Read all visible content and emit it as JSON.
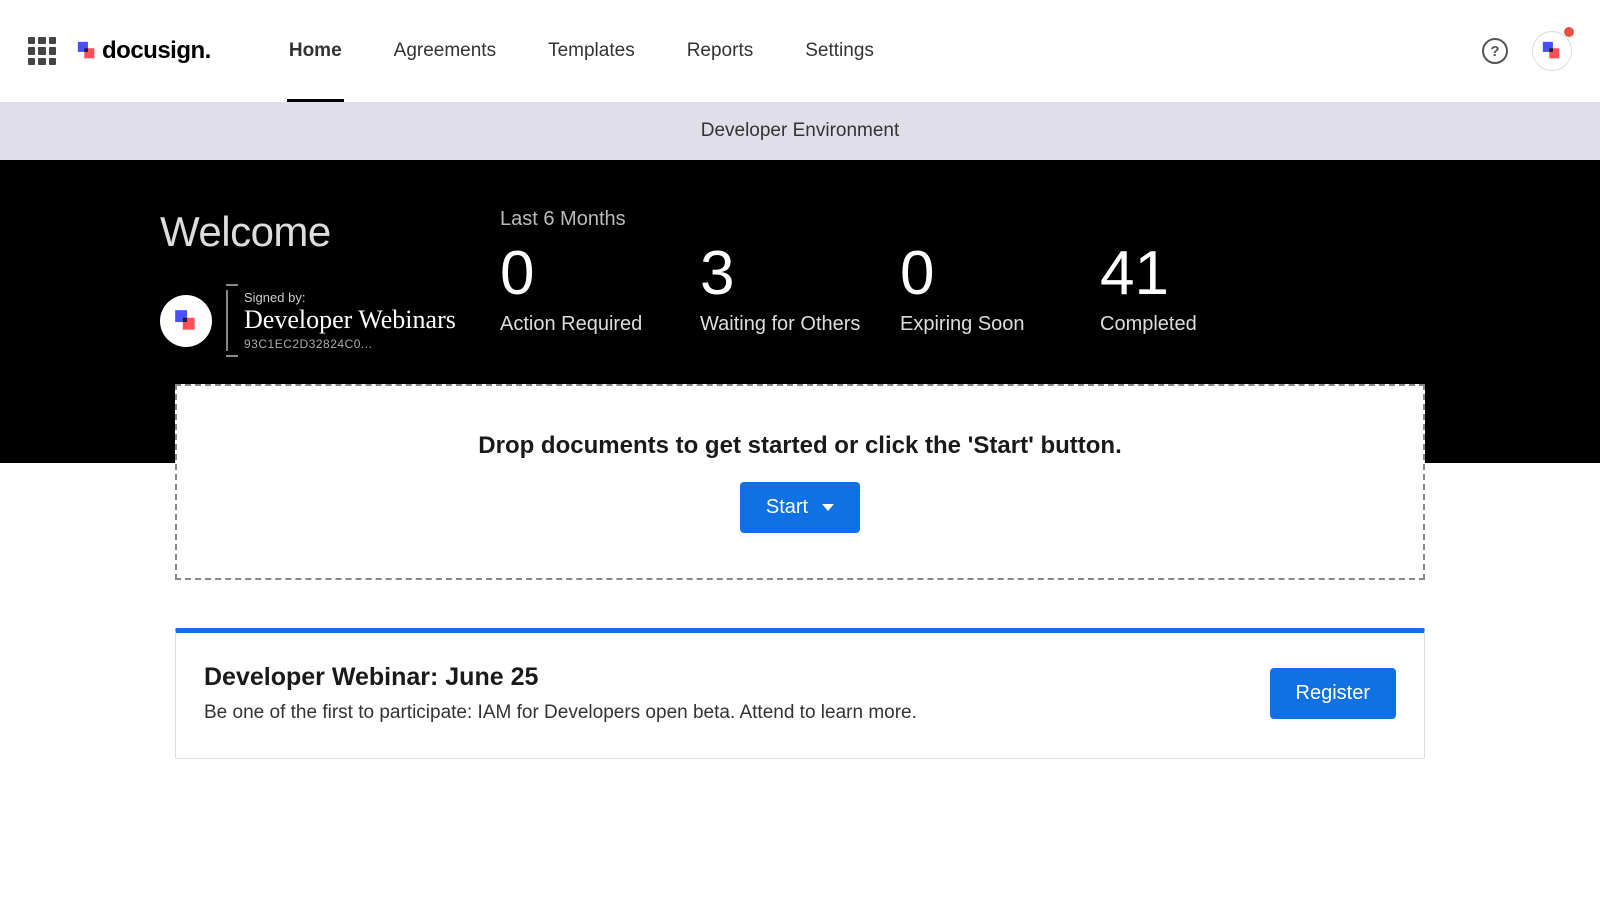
{
  "brand": {
    "name": "docusign"
  },
  "nav": {
    "items": [
      {
        "label": "Home",
        "active": true
      },
      {
        "label": "Agreements",
        "active": false
      },
      {
        "label": "Templates",
        "active": false
      },
      {
        "label": "Reports",
        "active": false
      },
      {
        "label": "Settings",
        "active": false
      }
    ]
  },
  "env_banner": "Developer Environment",
  "hero": {
    "welcome": "Welcome",
    "signed_by_label": "Signed by:",
    "signature_name": "Developer Webinars",
    "signature_hash": "93C1EC2D32824C0...",
    "period": "Last 6 Months",
    "stats": [
      {
        "value": "0",
        "label": "Action Required"
      },
      {
        "value": "3",
        "label": "Waiting for Others"
      },
      {
        "value": "0",
        "label": "Expiring Soon"
      },
      {
        "value": "41",
        "label": "Completed"
      }
    ]
  },
  "dropzone": {
    "text": "Drop documents to get started or click the 'Start' button.",
    "start_label": "Start"
  },
  "promo": {
    "title": "Developer Webinar: June 25",
    "body": "Be one of the first to participate: IAM for Developers open beta. Attend to learn more.",
    "register_label": "Register"
  },
  "help_glyph": "?"
}
